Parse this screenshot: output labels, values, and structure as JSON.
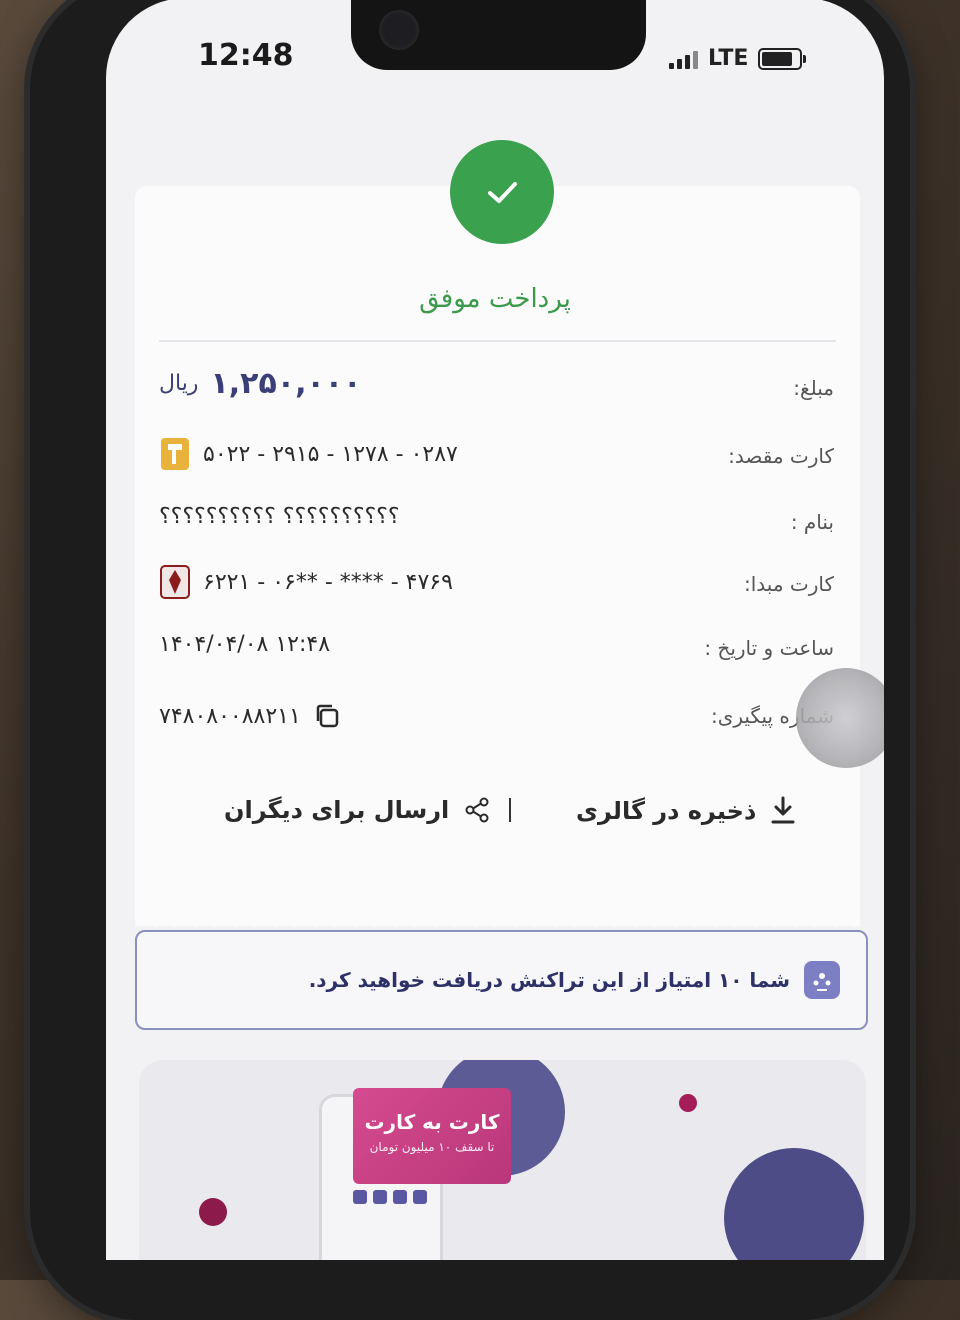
{
  "status_bar": {
    "time": "12:48",
    "network": "LTE"
  },
  "receipt": {
    "title": "پرداخت موفق",
    "rows": [
      {
        "label": "مبلغ:",
        "value": "۱,۲۵۰,۰۰۰",
        "unit": "ریال"
      },
      {
        "label": "کارت مقصد:",
        "value": "۵۰۲۲ - ۲۹۱۵ - ۱۲۷۸ - ۰۲۸۷"
      },
      {
        "label": "بنام :",
        "value": "؟؟؟؟؟؟؟؟؟؟ ؟؟؟؟؟؟؟؟؟؟"
      },
      {
        "label": "کارت مبدا:",
        "value": "۶۲۲۱ - ۰۶** - **** - ۴۷۶۹"
      },
      {
        "label": "ساعت و تاریخ :",
        "value": "۱۴۰۴/۰۴/۰۸ ۱۲:۴۸"
      },
      {
        "label": "شماره پیگیری:",
        "value": "۷۴۸۰۸۰۰۸۸۲۱۱"
      }
    ],
    "actions": {
      "save": "ذخیره در گالری",
      "share": "ارسال برای دیگران"
    }
  },
  "points_notice": "شما ۱۰ امتیاز از این تراکنش دریافت خواهید کرد.",
  "banner": {
    "title": "کارت به کارت",
    "subtitle": "تا سقف ۱۰ میلیون تومان"
  },
  "colors": {
    "success": "#3aa14e",
    "accent": "#3b3f78",
    "banner_card": "#c7407f"
  }
}
